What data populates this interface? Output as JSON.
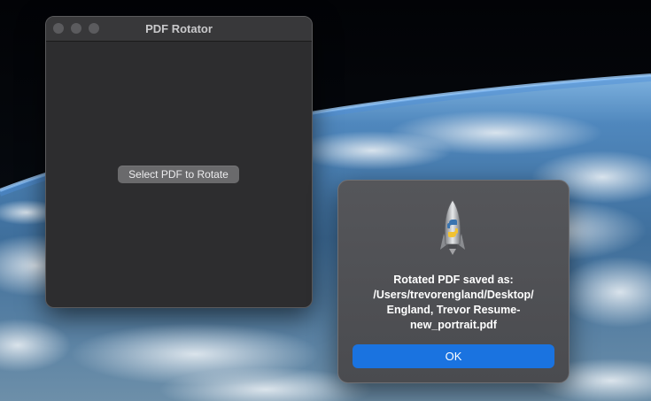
{
  "window": {
    "title": "PDF Rotator",
    "select_button_label": "Select PDF to Rotate"
  },
  "alert": {
    "icon": "python-rocket-icon",
    "message_lines": [
      "Rotated PDF saved as:",
      "/Users/trevorengland/Desktop/",
      "England, Trevor Resume-",
      "new_portrait.pdf"
    ],
    "ok_label": "OK"
  },
  "colors": {
    "accent": "#1a73e0",
    "window_bg": "#2d2d2f",
    "button_bg": "#6a6a6c"
  }
}
